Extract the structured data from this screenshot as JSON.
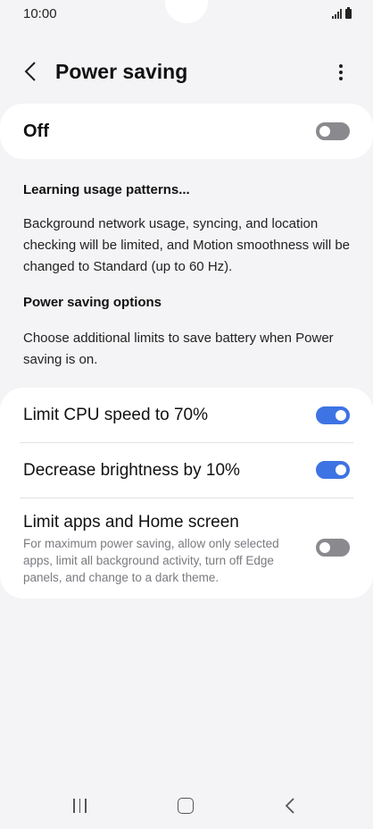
{
  "status_bar": {
    "time": "10:00"
  },
  "header": {
    "title": "Power saving"
  },
  "master": {
    "label": "Off",
    "enabled": false
  },
  "info": {
    "heading1": "Learning usage patterns...",
    "body1": "Background network usage, syncing, and location checking will be limited, and Motion smoothness will be changed to Standard (up to 60 Hz).",
    "heading2": "Power saving options",
    "body2": "Choose additional limits to save battery when Power saving is on."
  },
  "options": [
    {
      "title": "Limit CPU speed to 70%",
      "enabled": true
    },
    {
      "title": "Decrease brightness by 10%",
      "enabled": true
    },
    {
      "title": "Limit apps and Home screen",
      "description": "For maximum power saving, allow only selected apps, limit all background activity, turn off Edge panels, and change to a dark theme.",
      "enabled": false
    }
  ],
  "colors": {
    "accent": "#3e73e4",
    "toggle_off": "#8a8a8e",
    "background": "#f4f4f6",
    "card": "#ffffff"
  },
  "icons": [
    "chevron-left-icon",
    "more-vertical-icon",
    "signal-icon",
    "battery-icon",
    "nav-recents-icon",
    "nav-home-icon",
    "nav-back-icon"
  ]
}
